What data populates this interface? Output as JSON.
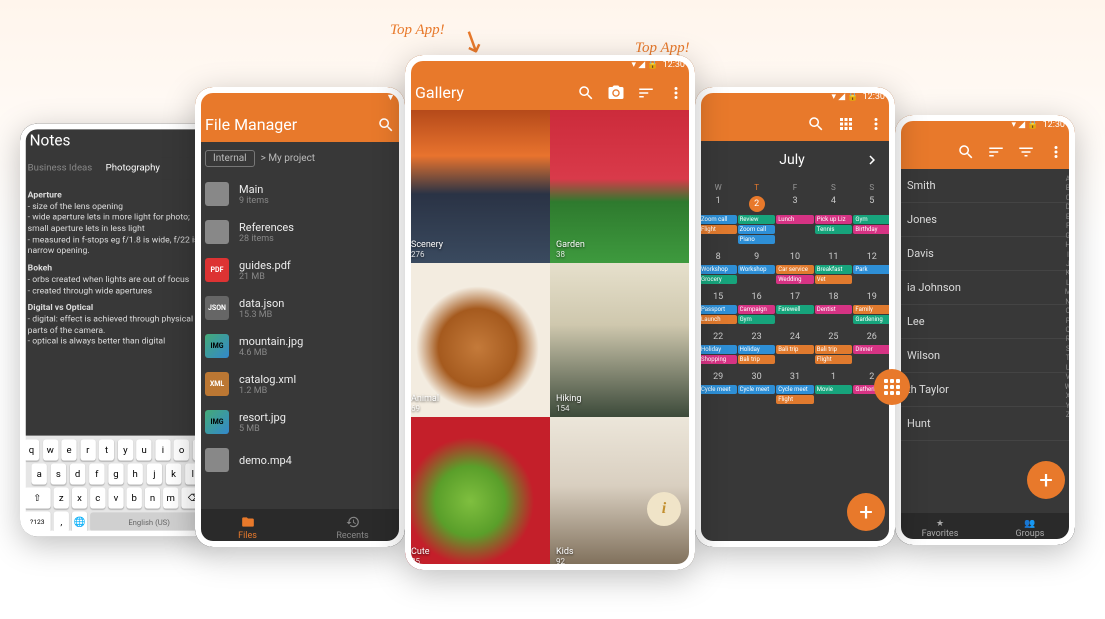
{
  "annotations": {
    "topApp1": "Top App!",
    "topApp2": "Top App!"
  },
  "statusTime": "12:30",
  "notes": {
    "title": "Notes",
    "tabs": {
      "t1": "Business Ideas",
      "t2": "Photography"
    },
    "body": {
      "h1": "Aperture",
      "l1": "- size of the lens opening",
      "l2": "- wide aperture lets in more light for photo; small aperture lets in less light",
      "l3": "- measured in f-stops eg f/1.8 is wide, f/22 is narrow opening.",
      "h2": "Bokeh",
      "l4": "- orbs created when lights are out of focus",
      "l5": "- created through wide apertures",
      "h3": "Digital vs Optical",
      "l6": "- digital: effect is achieved through physical parts of the camera.",
      "l7": "- optical is always better than digital"
    },
    "keyboard": {
      "space": "English (US)",
      "leftFn": "?123"
    }
  },
  "files": {
    "title": "File Manager",
    "crumbRoot": "Internal",
    "crumbPath": "> My project",
    "items": [
      {
        "name": "Main",
        "sub": "9 items",
        "type": "folder"
      },
      {
        "name": "References",
        "sub": "28 items",
        "type": "folder"
      },
      {
        "name": "guides.pdf",
        "sub": "21 MB",
        "type": "pdf"
      },
      {
        "name": "data.json",
        "sub": "15.3 MB",
        "type": "json"
      },
      {
        "name": "mountain.jpg",
        "sub": "4.6 MB",
        "type": "img"
      },
      {
        "name": "catalog.xml",
        "sub": "1.2 MB",
        "type": "xml"
      },
      {
        "name": "resort.jpg",
        "sub": "5 MB",
        "type": "img"
      },
      {
        "name": "demo.mp4",
        "sub": "",
        "type": "folder"
      }
    ],
    "nav": {
      "files": "Files",
      "recents": "Recents"
    }
  },
  "gallery": {
    "title": "Gallery",
    "albums": [
      {
        "name": "Scenery",
        "count": "276",
        "css": "linear-gradient(180deg,#b54a1a 0%,#e8732e 30%,#2a3345 55%,#3a4a5f 100%)"
      },
      {
        "name": "Garden",
        "count": "38",
        "css": "linear-gradient(180deg,#cc2b3b 0%,#d93a4a 45%,#2e7a2e 60%,#3e9a3e 100%)"
      },
      {
        "name": "Animal",
        "count": "69",
        "css": "radial-gradient(circle at 50% 55%,#c47a3a 0%,#a55a1e 35%,#f3ece0 55%)"
      },
      {
        "name": "Hiking",
        "count": "154",
        "css": "linear-gradient(180deg,#e6e0cc 0%,#cfc8ae 40%,#3c4a3a 100%)"
      },
      {
        "name": "Cute",
        "count": "85",
        "css": "radial-gradient(circle at 45% 55%,#7fbf3f 0%,#5a9f2a 30%,#c41f2a 55%)"
      },
      {
        "name": "Kids",
        "count": "92",
        "css": "linear-gradient(180deg,#ece6da 0%,#d9cfc0 45%,#7a6a55 100%)"
      }
    ]
  },
  "calendar": {
    "month": "July",
    "dow": [
      "W",
      "T",
      "F",
      "S",
      "S"
    ],
    "weeks": [
      {
        "days": [
          "1",
          "2",
          "3",
          "4",
          "5"
        ],
        "today": 1,
        "events": [
          [
            {
              "t": "Zoom call",
              "c": "#2e8fd6"
            },
            {
              "t": "Review",
              "c": "#17a47c"
            },
            {
              "t": "Lunch",
              "c": "#d63384"
            },
            {
              "t": "Pick up Liz",
              "c": "#d63384"
            },
            {
              "t": "Gym",
              "c": "#17a47c"
            }
          ],
          [
            {
              "t": "Flight",
              "c": "#e07a2e"
            },
            {
              "t": "Zoom call",
              "c": "#2e8fd6"
            },
            null,
            {
              "t": "Tennis",
              "c": "#17a47c"
            },
            {
              "t": "Birthday",
              "c": "#d63384"
            }
          ],
          [
            null,
            {
              "t": "Piano",
              "c": "#2e8fd6"
            },
            null,
            null,
            null
          ]
        ]
      },
      {
        "days": [
          "8",
          "9",
          "10",
          "11",
          "12"
        ],
        "today": -1,
        "events": [
          [
            {
              "t": "Workshop",
              "c": "#2e8fd6"
            },
            {
              "t": "Workshop",
              "c": "#2e8fd6"
            },
            {
              "t": "Car service",
              "c": "#e07a2e"
            },
            {
              "t": "Breakfast",
              "c": "#17a47c"
            },
            {
              "t": "Park",
              "c": "#2e8fd6"
            }
          ],
          [
            {
              "t": "Grocery",
              "c": "#17a47c"
            },
            null,
            {
              "t": "Wedding",
              "c": "#d63384"
            },
            {
              "t": "Vet",
              "c": "#e07a2e"
            },
            null
          ]
        ]
      },
      {
        "days": [
          "15",
          "16",
          "17",
          "18",
          "19"
        ],
        "today": -1,
        "events": [
          [
            {
              "t": "Passport",
              "c": "#2e8fd6"
            },
            {
              "t": "Campaign",
              "c": "#d63384"
            },
            {
              "t": "Farewell",
              "c": "#17a47c"
            },
            {
              "t": "Dentist",
              "c": "#d63384"
            },
            {
              "t": "Family",
              "c": "#e07a2e"
            }
          ],
          [
            {
              "t": "Launch",
              "c": "#e07a2e"
            },
            {
              "t": "Gym",
              "c": "#17a47c"
            },
            null,
            null,
            {
              "t": "Gardening",
              "c": "#17a47c"
            }
          ]
        ]
      },
      {
        "days": [
          "22",
          "23",
          "24",
          "25",
          "26"
        ],
        "today": -1,
        "events": [
          [
            {
              "t": "Holiday",
              "c": "#2e8fd6"
            },
            {
              "t": "Holiday",
              "c": "#2e8fd6"
            },
            {
              "t": "Bali trip",
              "c": "#e07a2e"
            },
            {
              "t": "Bali trip",
              "c": "#e07a2e"
            },
            {
              "t": "Dinner",
              "c": "#d63384"
            }
          ],
          [
            {
              "t": "Shopping",
              "c": "#d63384"
            },
            {
              "t": "Bali trip",
              "c": "#e07a2e"
            },
            null,
            {
              "t": "Flight",
              "c": "#e07a2e"
            },
            null
          ]
        ]
      },
      {
        "days": [
          "29",
          "30",
          "31",
          "1",
          "2"
        ],
        "today": -1,
        "events": [
          [
            {
              "t": "Cycle meet",
              "c": "#2e8fd6"
            },
            {
              "t": "Cycle meet",
              "c": "#2e8fd6"
            },
            {
              "t": "Cycle meet",
              "c": "#2e8fd6"
            },
            {
              "t": "Movie",
              "c": "#17a47c"
            },
            {
              "t": "Gathering",
              "c": "#d63384"
            }
          ],
          [
            null,
            null,
            {
              "t": "Flight",
              "c": "#e07a2e"
            },
            null,
            null
          ]
        ]
      }
    ]
  },
  "contacts": {
    "items": [
      "Smith",
      "Jones",
      "Davis",
      "ia Johnson",
      "Lee",
      "Wilson",
      "th Taylor",
      "Hunt"
    ],
    "nav": {
      "fav": "Favorites",
      "grp": "Groups"
    },
    "alpha": "ABCDEFGHIJKLMNOPQRSTUVWXYZ"
  }
}
